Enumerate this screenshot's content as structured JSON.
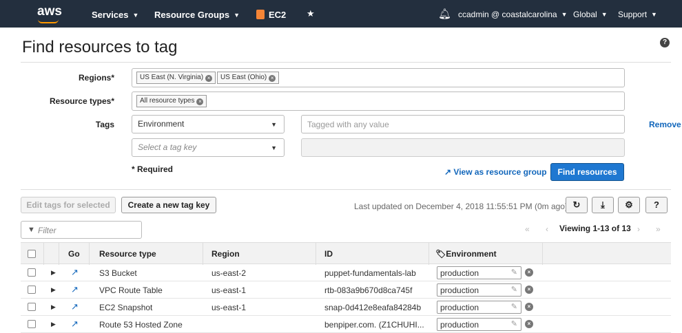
{
  "nav": {
    "logo": "aws",
    "services": "Services",
    "resource_groups": "Resource Groups",
    "ec2": "EC2",
    "user": "ccadmin @ coastalcarolina",
    "region": "Global",
    "support": "Support"
  },
  "page": {
    "title": "Find resources to tag"
  },
  "form": {
    "regions_label": "Regions*",
    "regions": [
      "US East (N. Virginia)",
      "US East (Ohio)"
    ],
    "resource_types_label": "Resource types*",
    "resource_types": [
      "All resource types"
    ],
    "tags_label": "Tags",
    "tag_key_1": "Environment",
    "tag_value_placeholder": "Tagged with any value",
    "tag_key_2_placeholder": "Select a tag key",
    "remove": "Remove",
    "required": "* Required",
    "view_as_group": "View as resource group",
    "find_resources": "Find resources"
  },
  "toolbar": {
    "edit_tags": "Edit tags for selected",
    "create_tag_key": "Create a new tag key",
    "last_updated": "Last updated on December 4, 2018 11:55:51 PM (0m ago)",
    "filter_placeholder": "Filter",
    "viewing": "Viewing 1-13 of 13"
  },
  "table": {
    "headers": {
      "go": "Go",
      "resource_type": "Resource type",
      "region": "Region",
      "id": "ID",
      "environment": "Environment"
    },
    "rows": [
      {
        "resource_type": "S3 Bucket",
        "region": "us-east-2",
        "id": "puppet-fundamentals-lab",
        "environment": "production"
      },
      {
        "resource_type": "VPC Route Table",
        "region": "us-east-1",
        "id": "rtb-083a9b670d8ca745f",
        "environment": "production"
      },
      {
        "resource_type": "EC2 Snapshot",
        "region": "us-east-1",
        "id": "snap-0d412e8eafa84284b",
        "environment": "production"
      },
      {
        "resource_type": "Route 53 Hosted Zone",
        "region": "",
        "id": "benpiper.com. (Z1CHUHI...",
        "environment": "production"
      }
    ]
  }
}
